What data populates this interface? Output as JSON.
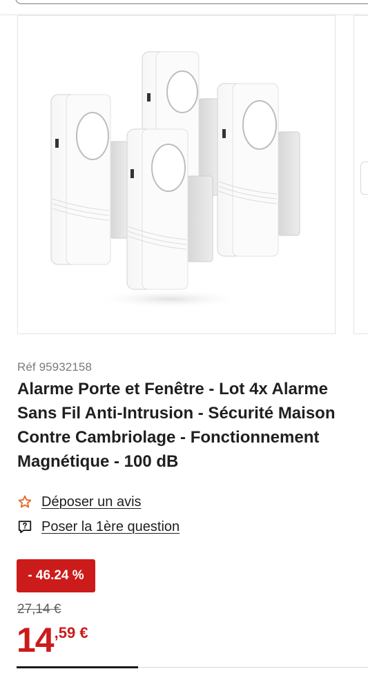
{
  "product": {
    "reference": "Réf 95932158",
    "title": "Alarme Porte et Fenêtre - Lot 4x Alarme\nSans Fil Anti-Intrusion - Sécurité Maison\nContre Cambriolage - Fonctionnement\nMagnétique - 100 dB",
    "image_icon": "door-window-alarm-product-photo"
  },
  "actions": {
    "review_label": "Déposer un avis",
    "review_icon": "star-outline-icon",
    "question_label": "Poser la 1ère question",
    "question_icon": "question-bubble-icon"
  },
  "pricing": {
    "discount": "- 46.24 %",
    "old_price": "27,14 €",
    "price_integer": "14",
    "price_cents": ",59 €"
  },
  "colors": {
    "accent_red": "#cc1b1b",
    "star_orange": "#e8651e"
  }
}
